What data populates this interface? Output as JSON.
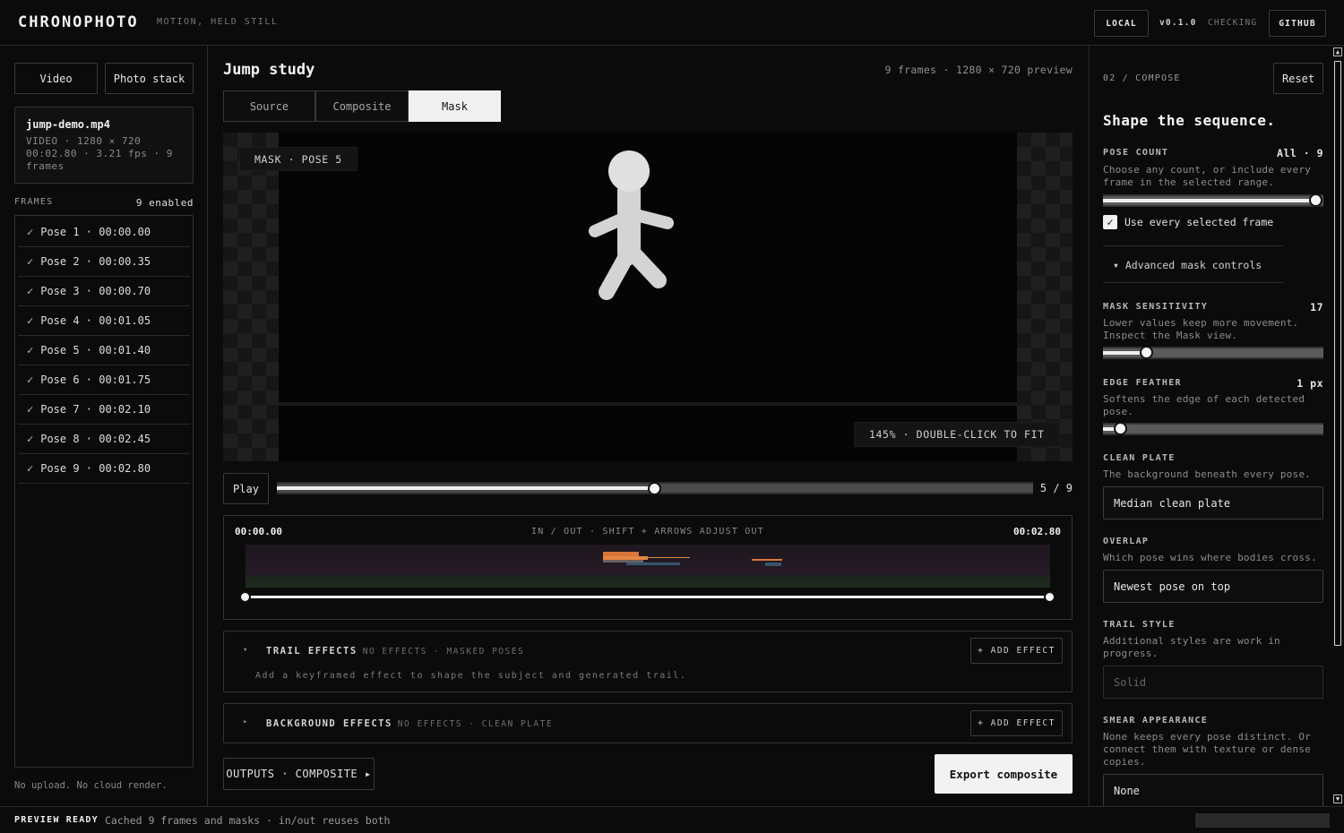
{
  "app": {
    "brand": "CHRONOPHOTO",
    "tagline": "MOTION, HELD STILL",
    "local_label": "LOCAL",
    "version": "v0.1.0",
    "update_status": "CHECKING",
    "github_label": "GITHUB"
  },
  "sidebar": {
    "modes": [
      "Video",
      "Photo stack"
    ],
    "file": {
      "name": "jump-demo.mp4",
      "meta_line1": "VIDEO · 1280 × 720",
      "meta_line2": "00:02.80 · 3.21 fps · 9",
      "meta_line3": "frames"
    },
    "frames_label": "FRAMES",
    "frames_count": "9 enabled",
    "frames": [
      {
        "label": "Pose 1 · 00:00.00",
        "enabled": true
      },
      {
        "label": "Pose 2 · 00:00.35",
        "enabled": true
      },
      {
        "label": "Pose 3 · 00:00.70",
        "enabled": true
      },
      {
        "label": "Pose 4 · 00:01.05",
        "enabled": true
      },
      {
        "label": "Pose 5 · 00:01.40",
        "enabled": true
      },
      {
        "label": "Pose 6 · 00:01.75",
        "enabled": true
      },
      {
        "label": "Pose 7 · 00:02.10",
        "enabled": true
      },
      {
        "label": "Pose 8 · 00:02.45",
        "enabled": true
      },
      {
        "label": "Pose 9 · 00:02.80",
        "enabled": true
      }
    ],
    "check_glyph": "✓",
    "footer": "No upload. No cloud render."
  },
  "main": {
    "title": "Jump study",
    "meta": "9 frames · 1280 × 720 preview",
    "tabs": [
      {
        "label": "Source",
        "active": false
      },
      {
        "label": "Composite",
        "active": false
      },
      {
        "label": "Mask",
        "active": true
      }
    ],
    "viewer_label": "MASK · POSE 5",
    "zoom_label": "145% · DOUBLE-CLICK TO FIT",
    "play_label": "Play",
    "frame_position": 0.5,
    "frame_counter": "5 / 9",
    "timeline": {
      "start": "00:00.00",
      "end": "00:02.80",
      "hint": "IN / OUT · SHIFT + ARROWS ADJUST OUT",
      "in_point": 0.0,
      "out_point": 1.0
    },
    "trail_effects": {
      "title": "TRAIL EFFECTS",
      "subtitle": "NO EFFECTS · MASKED POSES",
      "add_label": "+ ADD EFFECT",
      "description": "Add a keyframed effect to shape the subject and generated trail.",
      "caret": "▾"
    },
    "background_effects": {
      "title": "BACKGROUND EFFECTS",
      "subtitle": "NO EFFECTS · CLEAN PLATE",
      "add_label": "+ ADD EFFECT",
      "caret": "▸"
    },
    "outputs_label": "OUTPUTS · COMPOSITE ▸",
    "export_label": "Export composite"
  },
  "compose": {
    "step": "02 / COMPOSE",
    "reset_label": "Reset",
    "heading": "Shape the sequence.",
    "pose_count": {
      "label": "POSE COUNT",
      "value": "All · 9",
      "description": "Choose any count, or include every frame in the selected range.",
      "level": 1.0
    },
    "use_every_frame": {
      "label": "Use every selected frame",
      "checked": true
    },
    "advanced_label": "▾ Advanced mask controls",
    "mask_sensitivity": {
      "label": "MASK SENSITIVITY",
      "value": "17",
      "description": "Lower values keep more movement. Inspect the Mask view.",
      "level": 0.2
    },
    "edge_feather": {
      "label": "EDGE FEATHER",
      "value": "1 px",
      "description": "Softens the edge of each detected pose.",
      "level": 0.08
    },
    "clean_plate": {
      "label": "CLEAN PLATE",
      "description": "The background beneath every pose.",
      "selected": "Median clean plate"
    },
    "overlap": {
      "label": "OVERLAP",
      "description": "Which pose wins where bodies cross.",
      "selected": "Newest pose on top"
    },
    "trail_style": {
      "label": "TRAIL STYLE",
      "description": "Additional styles are work in progress.",
      "selected": "Solid"
    },
    "smear_appearance": {
      "label": "SMEAR APPEARANCE",
      "description": "None keeps every pose distinct. Or connect them with texture or dense copies.",
      "selected": "None"
    }
  },
  "status": {
    "state": "PREVIEW READY",
    "message": "Cached 9 frames and masks · in/out reuses both"
  }
}
